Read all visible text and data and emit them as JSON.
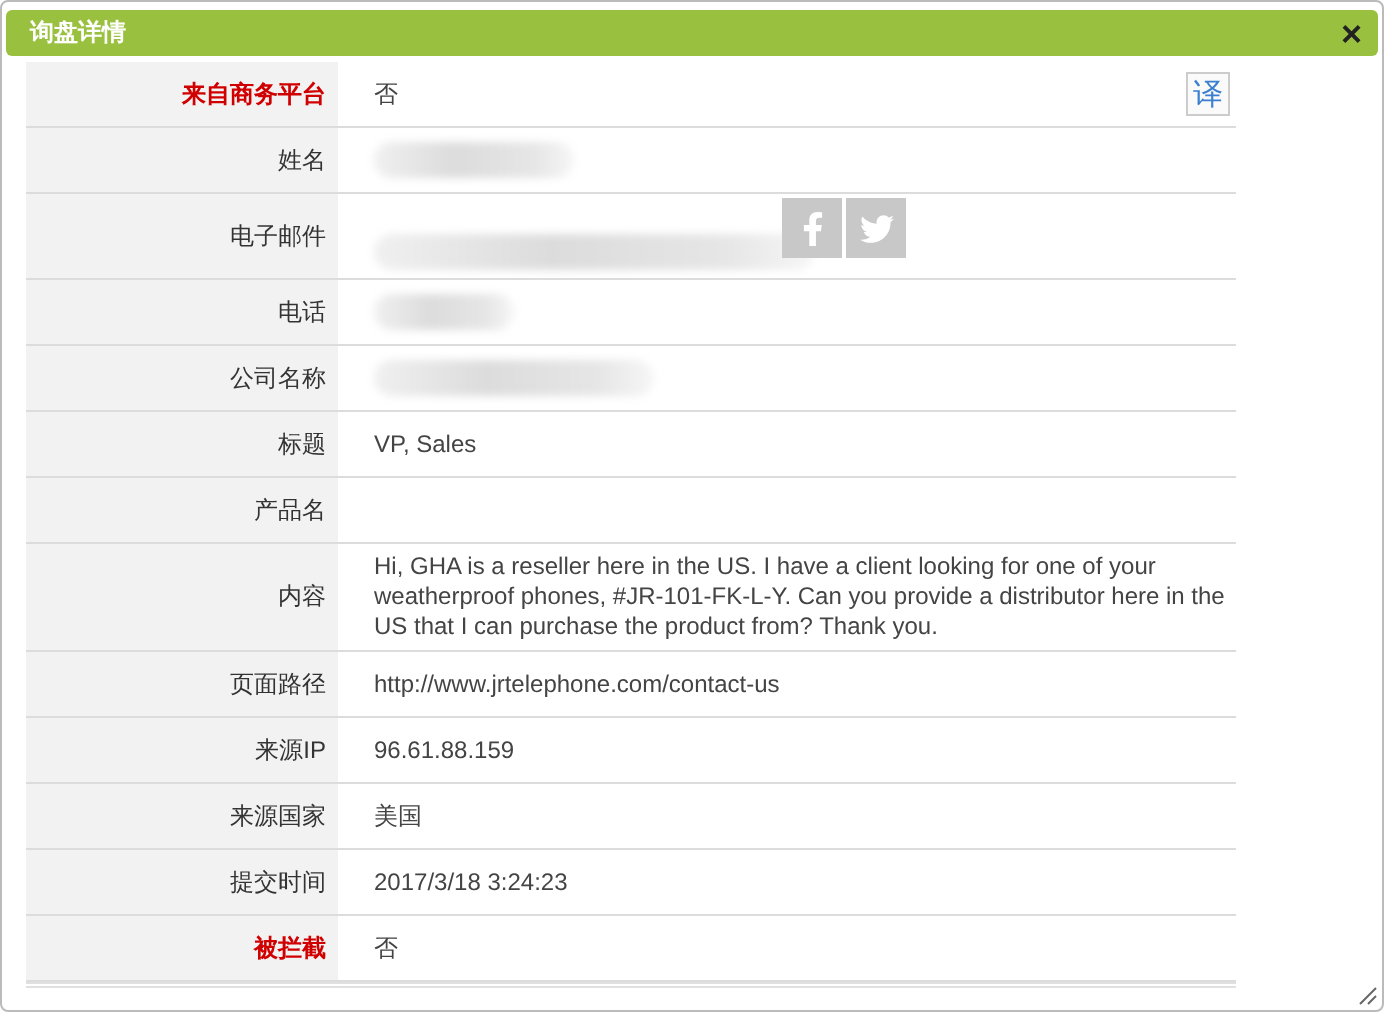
{
  "window": {
    "title": "询盘详情",
    "close": "×"
  },
  "translate_button": "译",
  "rows": [
    {
      "label": "来自商务平台",
      "highlight": true,
      "kind": "text",
      "value": "否"
    },
    {
      "label": "姓名",
      "highlight": false,
      "kind": "redacted"
    },
    {
      "label": "电子邮件",
      "highlight": false,
      "kind": "redacted",
      "social": true
    },
    {
      "label": "电话",
      "highlight": false,
      "kind": "redacted"
    },
    {
      "label": "公司名称",
      "highlight": false,
      "kind": "redacted"
    },
    {
      "label": "标题",
      "highlight": false,
      "kind": "text",
      "value": "VP, Sales"
    },
    {
      "label": "产品名",
      "highlight": false,
      "kind": "text"
    },
    {
      "label": "内容",
      "highlight": false,
      "kind": "text",
      "value": "Hi, GHA is a reseller here in the US. I have a client looking for one of your weatherproof phones, #JR-101-FK-L-Y. Can you provide a distributor here in the US that I can purchase the product from? Thank you."
    },
    {
      "label": "页面路径",
      "highlight": false,
      "kind": "text",
      "value": "http://www.jrtelephone.com/contact-us"
    },
    {
      "label": "来源IP",
      "highlight": false,
      "kind": "text",
      "value": "96.61.88.159"
    },
    {
      "label": "来源国家",
      "highlight": false,
      "kind": "text",
      "value": "美国"
    },
    {
      "label": "提交时间",
      "highlight": false,
      "kind": "text",
      "value": "2017/3/18 3:24:23"
    },
    {
      "label": "被拦截",
      "highlight": true,
      "kind": "text",
      "value": "否"
    }
  ]
}
